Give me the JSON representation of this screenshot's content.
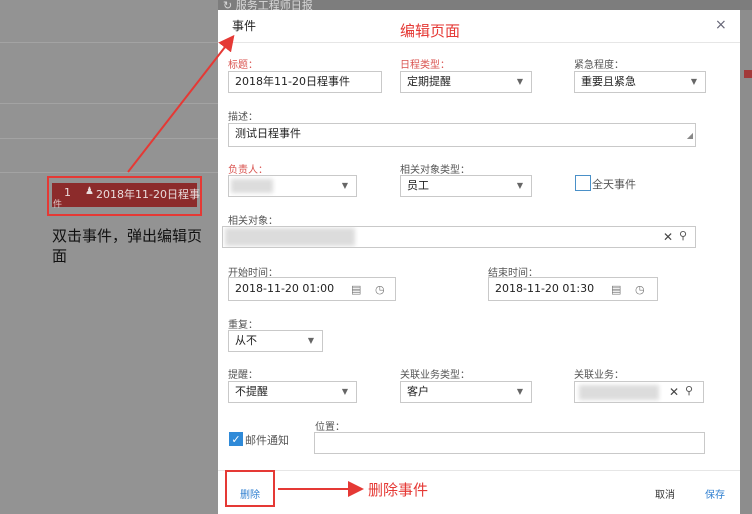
{
  "background": {
    "header_title": "服务工程师日报",
    "event_chip": {
      "number": "1",
      "title": "2018年11-20日程事",
      "subtitle": "件"
    },
    "note": "双击事件，弹出编辑页面"
  },
  "annotations": {
    "edit_page": "编辑页面",
    "delete_event": "删除事件"
  },
  "modal": {
    "title": "事件",
    "close_glyph": "×",
    "fields": {
      "title": {
        "label": "标题：",
        "value": "2018年11-20日程事件"
      },
      "schedule_type": {
        "label": "日程类型：",
        "value": "定期提醒"
      },
      "urgency": {
        "label": "紧急程度：",
        "value": "重要且紧急"
      },
      "description": {
        "label": "描述：",
        "value": "测试日程事件"
      },
      "owner": {
        "label": "负责人：",
        "value": ""
      },
      "related_type": {
        "label": "相关对象类型：",
        "value": "员工"
      },
      "all_day": {
        "label": "全天事件",
        "checked": false
      },
      "related_object": {
        "label": "相关对象：",
        "value": ""
      },
      "start_time": {
        "label": "开始时间：",
        "value": "2018-11-20 01:00"
      },
      "end_time": {
        "label": "结束时间：",
        "value": "2018-11-20 01:30"
      },
      "repeat": {
        "label": "重复：",
        "value": "从不"
      },
      "reminder": {
        "label": "提醒：",
        "value": "不提醒"
      },
      "business_type": {
        "label": "关联业务类型：",
        "value": "客户"
      },
      "business": {
        "label": "关联业务：",
        "value": ""
      },
      "email_notify": {
        "label": "邮件通知",
        "checked": true
      },
      "location": {
        "label": "位置：",
        "value": ""
      }
    },
    "buttons": {
      "delete": "删除",
      "cancel": "取消",
      "save": "保存"
    }
  },
  "colors": {
    "accent": "#2f7fd0",
    "highlight": "#e53935",
    "required": "#d9534f",
    "event_chip": "#8c2b2b"
  }
}
